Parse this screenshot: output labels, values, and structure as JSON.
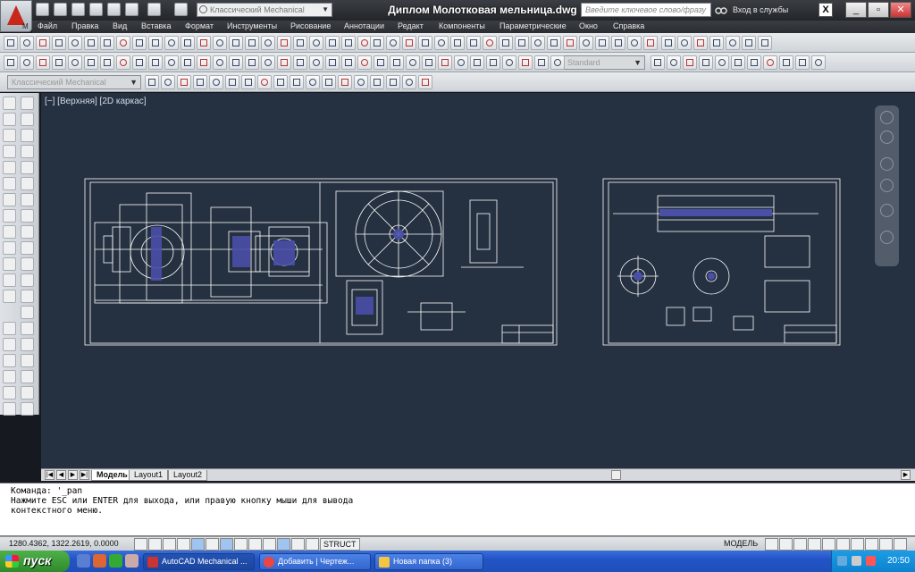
{
  "app": {
    "title": "Диплом Молотковая мельница.dwg",
    "workspace": "Классический Mechanical",
    "search_placeholder": "Введите ключевое слово/фразу",
    "signin": "Вход в службы",
    "x_label": "X"
  },
  "menu": [
    "Файл",
    "Правка",
    "Вид",
    "Вставка",
    "Формат",
    "Инструменты",
    "Рисование",
    "Аннотации",
    "Редакт",
    "Компоненты",
    "Параметрические",
    "Окно",
    "Справка"
  ],
  "toolbar3": {
    "workspace_combo": "Классический Mechanical"
  },
  "toolbar2": {
    "style_combo": "Standard"
  },
  "viewport": {
    "label": "[−] [Верхняя] [2D каркас]"
  },
  "layout_tabs": [
    "Модель",
    "Layout1",
    "Layout2"
  ],
  "command": {
    "lines": [
      "Команда: '_pan",
      "Нажмите ESC или ENTER для выхода, или правую кнопку мыши для вывода",
      "контекстного меню."
    ]
  },
  "status": {
    "coords": "1280.4362, 1322.2619, 0.0000",
    "struct": "STRUCT",
    "model": "МОДЕЛЬ"
  },
  "taskbar": {
    "start": "пуск",
    "tasks": [
      "AutoCAD Mechanical ...",
      "Добавить | Чертеж...",
      "Новая папка (3)"
    ],
    "clock": "20:50"
  },
  "colors": {
    "viewport_bg": "#253040",
    "drawing_line": "#ffffff",
    "accent_blue": "#1f4fb8",
    "start_green": "#2f8a2b"
  }
}
